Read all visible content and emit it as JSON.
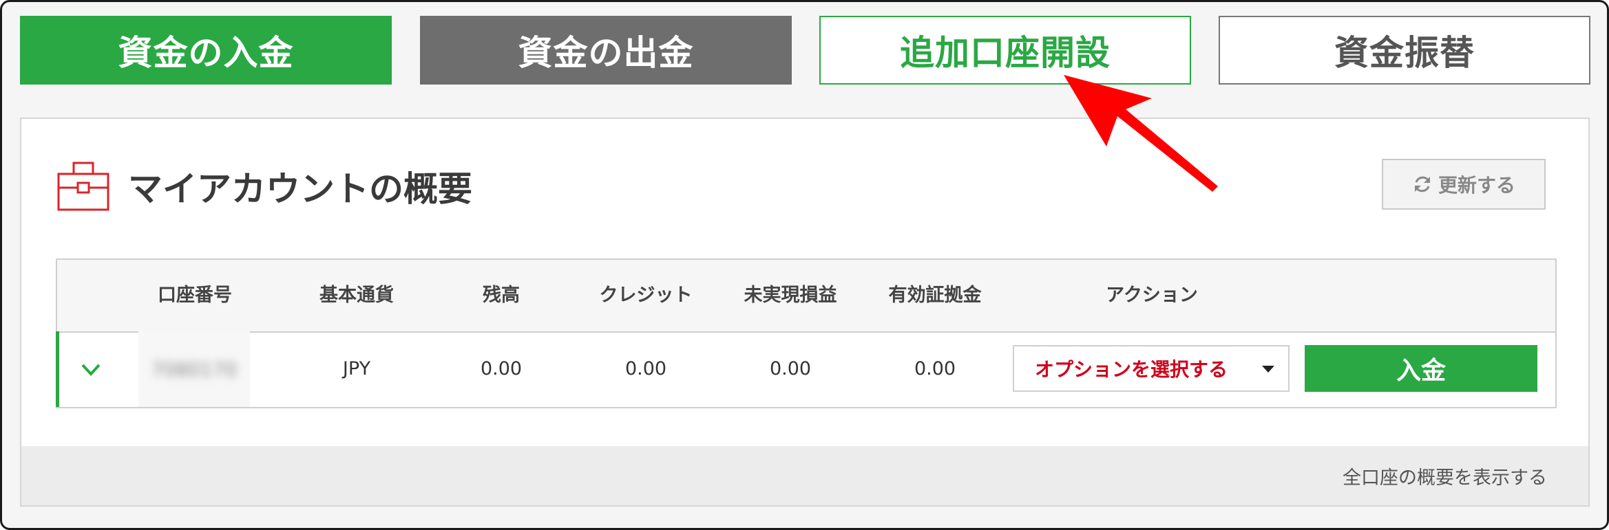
{
  "tabs": {
    "deposit": "資金の入金",
    "withdraw": "資金の出金",
    "open_account": "追加口座開設",
    "transfer": "資金振替"
  },
  "panel": {
    "title": "マイアカウントの概要",
    "title_icon": "briefcase-icon",
    "refresh_label": "更新する",
    "refresh_icon": "refresh-icon"
  },
  "table": {
    "headers": {
      "account_number": "口座番号",
      "base_currency": "基本通貨",
      "balance": "残高",
      "credit": "クレジット",
      "unrealized_pl": "未実現損益",
      "margin": "有効証拠金",
      "action": "アクション"
    },
    "rows": [
      {
        "account_number": "7080170",
        "base_currency": "JPY",
        "balance": "0.00",
        "credit": "0.00",
        "unrealized_pl": "0.00",
        "margin": "0.00",
        "select_label": "オプションを選択する",
        "deposit_label": "入金"
      }
    ]
  },
  "footer": {
    "show_all_label": "全口座の概要を表示する"
  },
  "colors": {
    "green": "#2aa844",
    "gray": "#6e6e6e",
    "red": "#d0021b",
    "annotation_arrow": "#ff0000"
  }
}
